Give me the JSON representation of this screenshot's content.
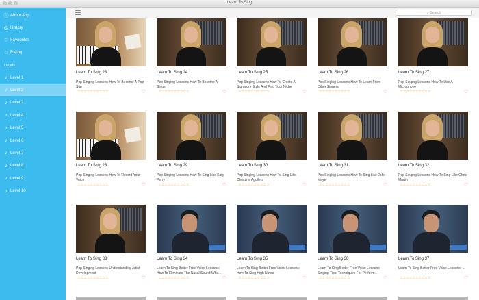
{
  "window": {
    "title": "Learn To Sing"
  },
  "sidebar": {
    "top_items": [
      {
        "label": "About App",
        "icon": "info-icon",
        "glyph": "ⓘ"
      },
      {
        "label": "History",
        "icon": "clock-icon",
        "glyph": "◷"
      },
      {
        "label": "Favourites",
        "icon": "heart-icon",
        "glyph": "♡"
      },
      {
        "label": "Rating",
        "icon": "star-icon",
        "glyph": "☆"
      }
    ],
    "section_label": "Levels",
    "levels": [
      {
        "label": "Level 1",
        "icon": "music-note-icon",
        "glyph": "♪"
      },
      {
        "label": "Level 2",
        "icon": "music-note-icon",
        "glyph": "♪",
        "active": true
      },
      {
        "label": "Level 3",
        "icon": "music-note-icon",
        "glyph": "♪"
      },
      {
        "label": "Level 4",
        "icon": "music-note-icon",
        "glyph": "♪"
      },
      {
        "label": "Level 5",
        "icon": "music-note-icon",
        "glyph": "♪"
      },
      {
        "label": "Level 6",
        "icon": "music-note-icon",
        "glyph": "♪"
      },
      {
        "label": "Level 7",
        "icon": "music-note-icon",
        "glyph": "♪"
      },
      {
        "label": "Level 8",
        "icon": "music-note-icon",
        "glyph": "♪"
      },
      {
        "label": "Level 9",
        "icon": "music-note-icon",
        "glyph": "♪"
      },
      {
        "label": "Level 10",
        "icon": "music-note-icon",
        "glyph": "♪"
      }
    ],
    "background_color": "#3cbbee",
    "active_color": "#7fd3f5"
  },
  "toolbar": {
    "menu_icon": "list-icon",
    "search_placeholder": "Search",
    "search_icon": "search-icon"
  },
  "videos": [
    {
      "title": "Learn To Sing 23",
      "desc": "Pop Singing Lessons How To Become A Pop Star",
      "thumb": "piano"
    },
    {
      "title": "Learn To Sing 24",
      "desc": "Pop Singing Lessons How To Become A Singer",
      "thumb": "woman"
    },
    {
      "title": "Learn To Sing 25",
      "desc": "Pop Singing Lessons How To Create A Signature Style And Find Your Niche",
      "thumb": "woman"
    },
    {
      "title": "Learn To Sing 26",
      "desc": "Pop Singing Lessons How To Learn From Other Singers",
      "thumb": "woman"
    },
    {
      "title": "Learn To Sing 27",
      "desc": "Pop Singing Lessons How To Use A Microphone",
      "thumb": "woman"
    },
    {
      "title": "Learn To Sing 28",
      "desc": "Pop Singing Lessons How To Record Your Voice",
      "thumb": "piano"
    },
    {
      "title": "Learn To Sing 29",
      "desc": "Pop Singing Lessons How To Sing Like Katy Perry",
      "thumb": "woman"
    },
    {
      "title": "Learn To Sing 30",
      "desc": "Pop Singing Lessons How To Sing Like Christina Aguilera",
      "thumb": "woman"
    },
    {
      "title": "Learn To Sing 31",
      "desc": "Pop Singing Lessons How To Sing Like John Mayer",
      "thumb": "woman"
    },
    {
      "title": "Learn To Sing 32",
      "desc": "Pop Singing Lessons How To Sing Like Chris Martin",
      "thumb": "woman"
    },
    {
      "title": "Learn To Sing 33",
      "desc": "Pop Singing Lessons Understanding Artist Development",
      "thumb": "woman"
    },
    {
      "title": "Learn To Sing 34",
      "desc": "Learn To Sing Better Free Voice Lessons: How To Eliminate The Nasal Sound Whe...",
      "thumb": "man"
    },
    {
      "title": "Learn To Sing 35",
      "desc": "Learn To Sing Better Free Voice Lessons: How To Sing High Notes",
      "thumb": "man"
    },
    {
      "title": "Learn To Sing 36",
      "desc": "Learn To Sing Better Free Voice Lessons Singing Tips: Techniques For Perform...",
      "thumb": "man"
    },
    {
      "title": "Learn To Sing 37",
      "desc": "Learn To Sing Better Free Voice Lessons: ...",
      "thumb": "man"
    }
  ],
  "rating_stars": "☆☆☆☆☆☆☆☆☆☆",
  "favorite_glyph": "♡",
  "accent_color": "#e0507a",
  "star_color": "#e2a53a"
}
